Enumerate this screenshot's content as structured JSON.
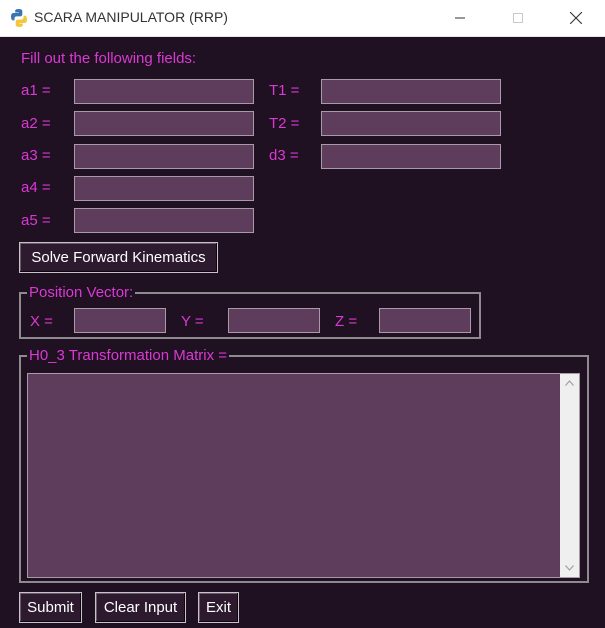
{
  "window": {
    "title": "SCARA MANIPULATOR (RRP)"
  },
  "form": {
    "heading": "Fill out the following fields:",
    "fields_left": [
      {
        "label": "a1 =",
        "value": ""
      },
      {
        "label": "a2 =",
        "value": ""
      },
      {
        "label": "a3 =",
        "value": ""
      },
      {
        "label": "a4 =",
        "value": ""
      },
      {
        "label": "a5 =",
        "value": ""
      }
    ],
    "fields_right": [
      {
        "label": "T1 =",
        "value": ""
      },
      {
        "label": "T2 =",
        "value": ""
      },
      {
        "label": "d3 =",
        "value": ""
      }
    ],
    "solve_button": "Solve Forward Kinematics"
  },
  "position_vector": {
    "legend": "Position Vector:",
    "x_label": "X =",
    "y_label": "Y =",
    "z_label": "Z =",
    "x_value": "",
    "y_value": "",
    "z_value": ""
  },
  "matrix": {
    "legend": "H0_3 Transformation Matrix =",
    "content": ""
  },
  "footer": {
    "submit": "Submit",
    "clear": "Clear Input",
    "exit": "Exit"
  },
  "colors": {
    "background": "#1f1022",
    "label": "#d93ad2",
    "field": "#5d3d5b"
  }
}
